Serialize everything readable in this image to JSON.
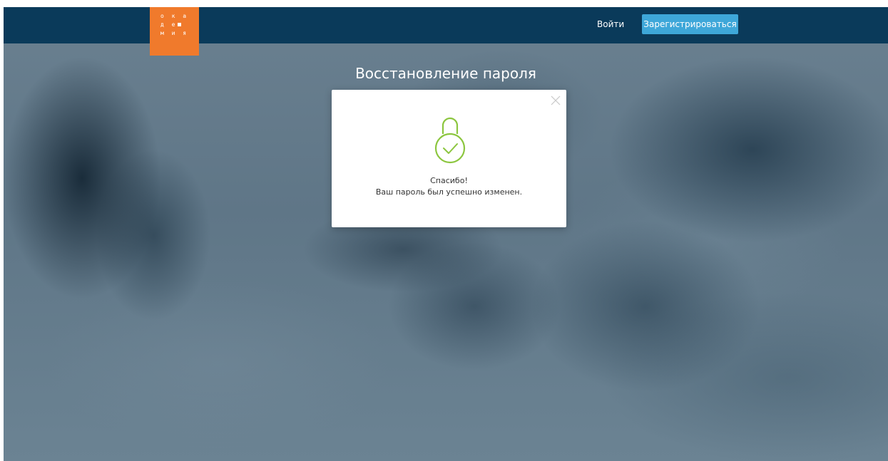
{
  "header": {
    "logo": {
      "rows": [
        "о к а",
        "д е",
        "м и я"
      ],
      "color": "#f07a2c"
    },
    "login_label": "Войти",
    "register_label": "Зарегистрироваться",
    "bar_color": "#0a3a5a",
    "register_color": "#3ea7d9"
  },
  "main": {
    "title": "Восстановление пароля"
  },
  "modal": {
    "icon": "lock-check-icon",
    "icon_color": "#8cc63f",
    "close_icon": "close-icon",
    "message_line1": "Спасибо!",
    "message_line2": "Ваш пароль был успешно изменен."
  }
}
